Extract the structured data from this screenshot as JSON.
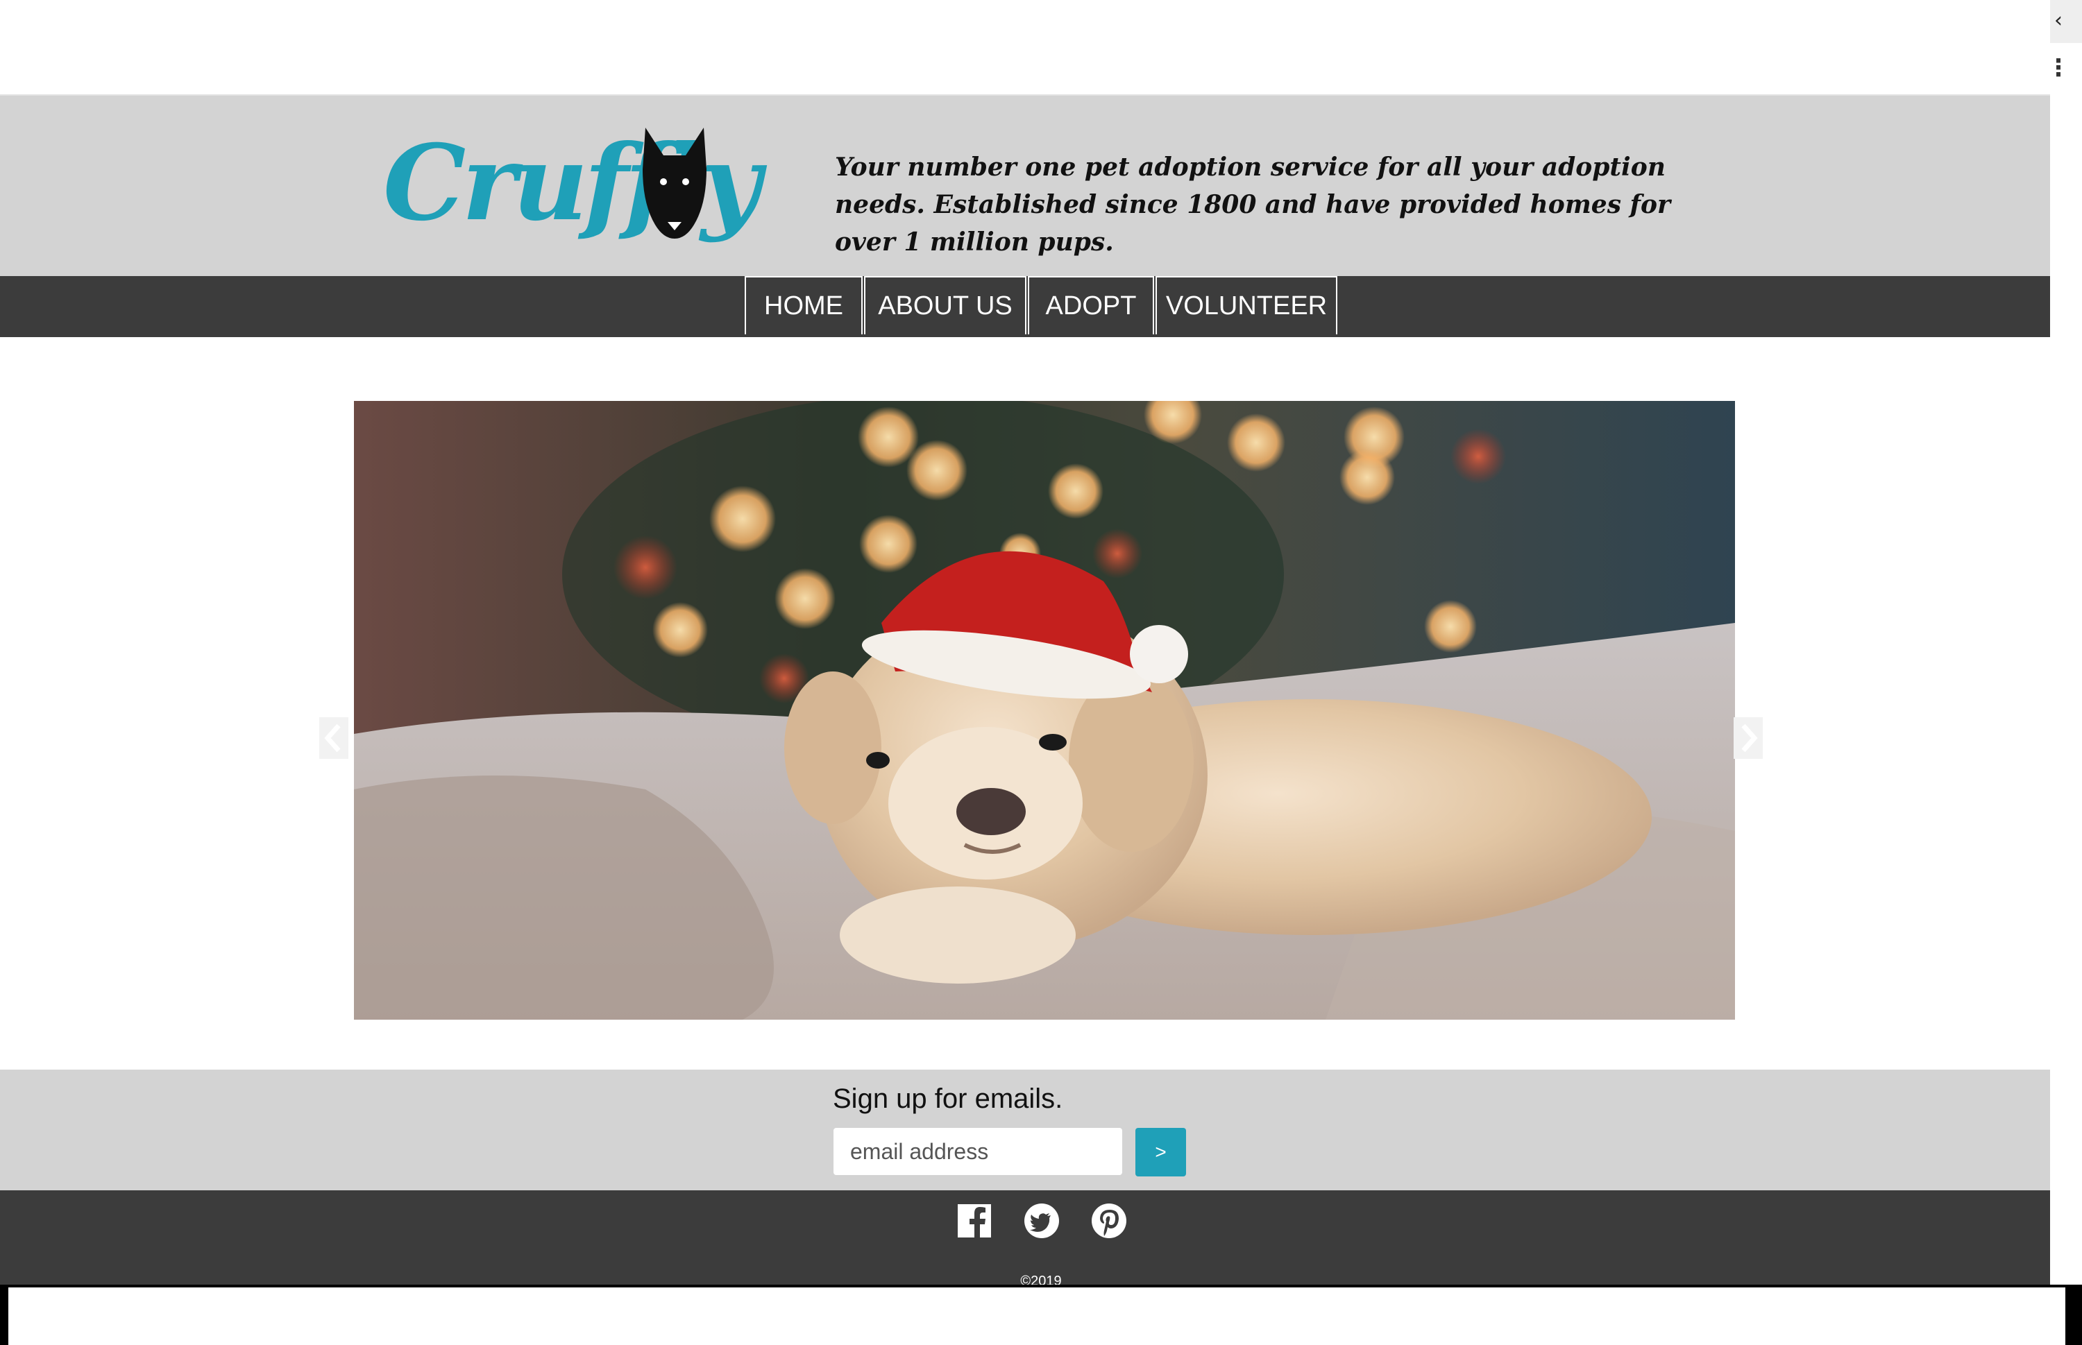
{
  "header": {
    "logo_text": "Cruffly",
    "tagline": "Your number one pet adoption service for all your adoption needs. Established since 1800 and have provided homes for over 1 million pups."
  },
  "nav": {
    "items": [
      {
        "label": "HOME"
      },
      {
        "label": "ABOUT US"
      },
      {
        "label": "ADOPT"
      },
      {
        "label": "VOLUNTEER"
      }
    ]
  },
  "carousel": {
    "image_alt": "Puppy wearing a Santa hat on a blanket",
    "prev_icon": "chevron-left-icon",
    "next_icon": "chevron-right-icon"
  },
  "signup": {
    "title": "Sign up for emails.",
    "placeholder": "email address",
    "submit_label": ">"
  },
  "footer": {
    "social": [
      "facebook-icon",
      "twitter-icon",
      "pinterest-icon"
    ],
    "copyright": "©2019"
  },
  "colors": {
    "accent": "#1fa0b8",
    "header_bg": "#d3d3d3",
    "nav_bg": "#3c3c3c"
  }
}
